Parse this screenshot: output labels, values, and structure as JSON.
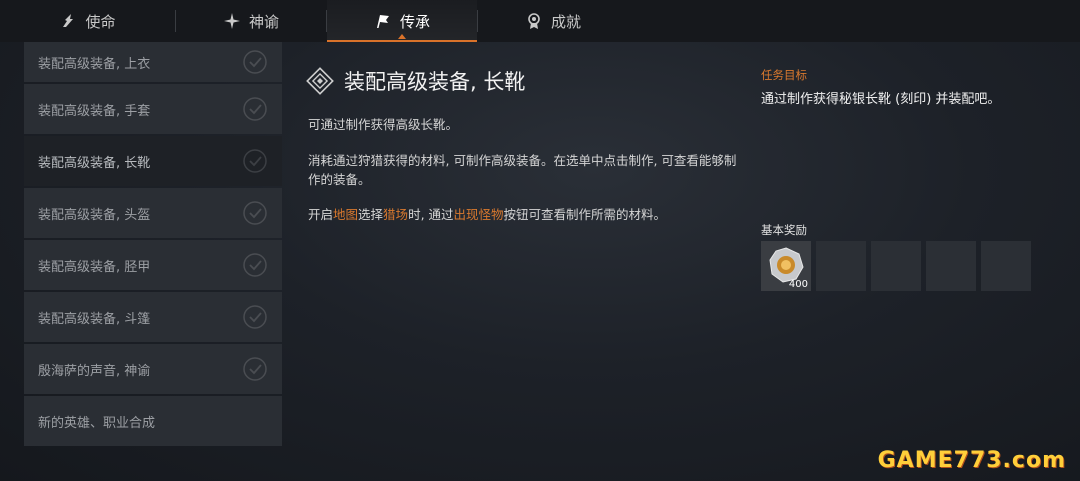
{
  "tabs": [
    {
      "label": "使命",
      "icon": "wing-icon"
    },
    {
      "label": "神谕",
      "icon": "star-icon"
    },
    {
      "label": "传承",
      "icon": "flag-icon",
      "active": true
    },
    {
      "label": "成就",
      "icon": "medal-icon"
    }
  ],
  "quests": [
    {
      "label": "装配高级装备, 上衣"
    },
    {
      "label": "装配高级装备, 手套"
    },
    {
      "label": "装配高级装备, 长靴",
      "selected": true
    },
    {
      "label": "装配高级装备, 头盔"
    },
    {
      "label": "装配高级装备, 胫甲"
    },
    {
      "label": "装配高级装备, 斗篷"
    },
    {
      "label": "殷海萨的声音, 神谕"
    },
    {
      "label": "新的英雄、职业合成"
    }
  ],
  "detail": {
    "title": "装配高级装备, 长靴",
    "para1": "可通过制作获得高级长靴。",
    "para2": "消耗通过狩猎获得的材料, 可制作高级装备。在选单中点击制作, 可查看能够制作的装备。",
    "para3": {
      "t1": "开启",
      "h1": "地图",
      "t2": "选择",
      "h2": "猎场",
      "t3": "时, 通过",
      "h3": "出现怪物",
      "t4": "按钮可查看制作所需的材料。"
    }
  },
  "goal": {
    "label": "任务目标",
    "text": "通过制作获得秘银长靴 (刻印) 并装配吧。"
  },
  "reward": {
    "label": "基本奖励",
    "items": [
      {
        "icon": "coin-icon",
        "qty": "400"
      }
    ]
  },
  "watermark": "GAME773.com",
  "colors": {
    "accent": "#d9722a"
  }
}
